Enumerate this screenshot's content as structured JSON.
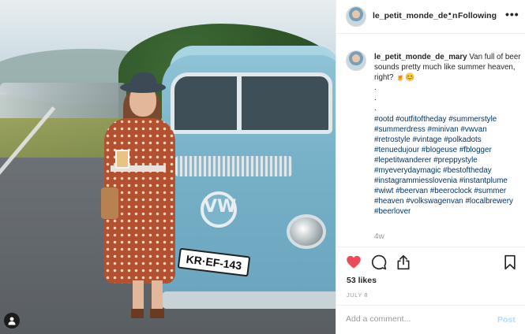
{
  "post": {
    "license_plate": "KR·EF-143",
    "van_badge": "VW"
  },
  "header": {
    "username": "le_petit_monde_de_n",
    "separator": "•",
    "follow_label": "Following",
    "more_glyph": "•••"
  },
  "caption": {
    "username": "le_petit_monde_de_mary",
    "text": "Van full of beer sounds pretty much like summer heaven, right? 🍺😊",
    "dots": [
      ".",
      ".",
      "."
    ],
    "hashtags": "#ootd #outfitoftheday #summerstyle #summerdress #minivan #vwvan #retrostyle #vintage #polkadots #tenuedujour #blogeuse #fblogger #lepetitwanderer #preppystyle #myeverydaymagic #bestoftheday #instagrammiesslovenia #instantplume #wiwt #beervan #beeroclock #summer #heaven #volkswagenvan #localbrewery #beerlover",
    "time_ago": "4w"
  },
  "actions": {
    "like_icon": "heart-icon",
    "comment_icon": "comment-icon",
    "share_icon": "share-icon",
    "save_icon": "bookmark-icon",
    "like_color": "#ed4956"
  },
  "stats": {
    "likes": "53 likes",
    "date": "JULY 8"
  },
  "comment": {
    "placeholder": "Add a comment...",
    "post_label": "Post"
  }
}
